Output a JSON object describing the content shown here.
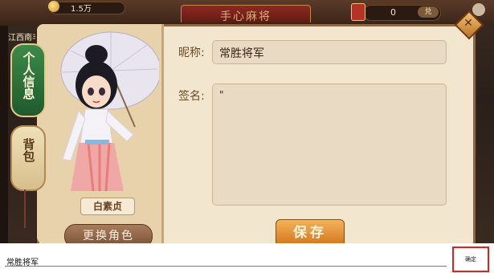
{
  "header": {
    "gold_amount": "1.5万",
    "title": "手心麻将",
    "cards_count": "0",
    "cards_button": "兑",
    "province": "江西南丰"
  },
  "tabs": [
    {
      "label": "个人信息",
      "active": true
    },
    {
      "label": "背包",
      "active": false
    }
  ],
  "character": {
    "name": "白素贞",
    "change_button": "更换角色"
  },
  "form": {
    "nickname_label": "昵称:",
    "nickname_value": "常胜将军",
    "signature_label": "签名:",
    "signature_value": "\"",
    "save_button": "保存"
  },
  "ime": {
    "input_text": "常胜将军",
    "confirm_button": "确定"
  },
  "colors": {
    "panel_bg": "#f3e6cf",
    "active_tab": "#2f7a3d",
    "save_button": "#e8962e",
    "ime_confirm_border": "#e0221e"
  }
}
